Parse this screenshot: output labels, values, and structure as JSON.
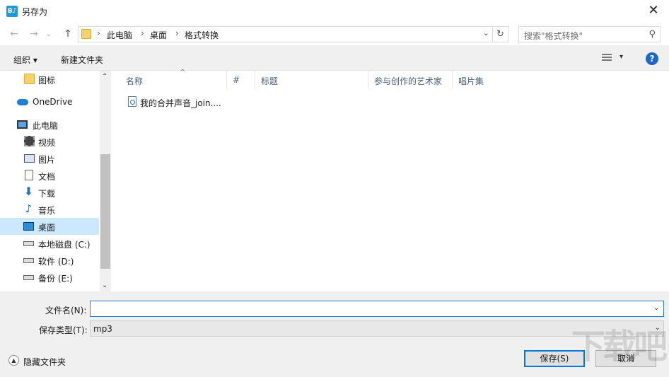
{
  "window": {
    "title": "另存为",
    "app_icon_text": "B♪",
    "close_glyph": "✕"
  },
  "nav": {
    "back_glyph": "←",
    "forward_glyph": "→",
    "recent_glyph": "⌄",
    "up_glyph": "↑",
    "breadcrumb": [
      "此电脑",
      "桌面",
      "格式转换"
    ],
    "crumb_sep": "›",
    "address_chevron": "⌄",
    "refresh_glyph": "↻",
    "search_placeholder": "搜索\"格式转换\"",
    "search_glyph": "⚲"
  },
  "toolbar": {
    "organize": "组织 ▾",
    "new_folder": "新建文件夹",
    "view_chevron": "▾",
    "help": "?"
  },
  "sidebar": {
    "items": [
      {
        "label": "图标",
        "icon": "folder-icon"
      },
      {
        "label": "OneDrive",
        "icon": "onedrive-icon"
      },
      {
        "label": "此电脑",
        "icon": "pc-icon"
      },
      {
        "label": "视频",
        "icon": "video-icon"
      },
      {
        "label": "图片",
        "icon": "picture-icon"
      },
      {
        "label": "文档",
        "icon": "document-icon"
      },
      {
        "label": "下载",
        "icon": "download-icon"
      },
      {
        "label": "音乐",
        "icon": "music-icon"
      },
      {
        "label": "桌面",
        "icon": "desktop-icon",
        "selected": true
      },
      {
        "label": "本地磁盘 (C:)",
        "icon": "drive-icon"
      },
      {
        "label": "软件 (D:)",
        "icon": "drive-icon"
      },
      {
        "label": "备份 (E:)",
        "icon": "drive-icon"
      }
    ],
    "download_glyph": "⬇",
    "music_glyph": "♪",
    "scroll_up": "⌃",
    "scroll_down": "⌄"
  },
  "columns": [
    "名称",
    "#",
    "标题",
    "参与创作的艺术家",
    "唱片集"
  ],
  "sort_glyph": "^",
  "files": [
    {
      "name": "我的合并声音_join....",
      "icon": "audio-file-icon"
    }
  ],
  "form": {
    "filename_label": "文件名(N):",
    "filename_value": "",
    "filename_chevron": "⌄",
    "type_label": "保存类型(T):",
    "type_value": "mp3",
    "type_chevron": "⌄"
  },
  "footer": {
    "hide_folders": "隐藏文件夹",
    "hide_glyph": "▲",
    "save": "保存(S)",
    "cancel": "取消"
  },
  "watermark": "下载吧"
}
